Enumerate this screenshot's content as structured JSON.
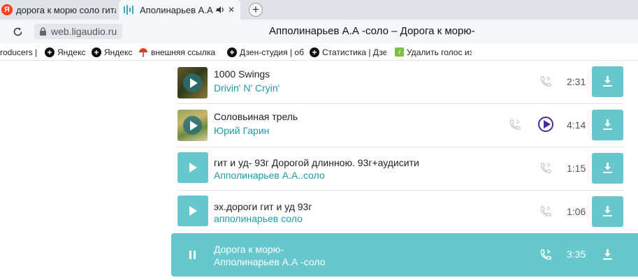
{
  "tabs": [
    {
      "label": "дорога к морю соло гитар",
      "icon": "yandex-icon",
      "icon_letter": "Я"
    },
    {
      "label": "Аполинарьев А.А -соло",
      "icon": "waveform-icon",
      "close": "✕"
    }
  ],
  "new_tab": "+",
  "address": {
    "url": "web.ligaudio.ru",
    "title": "Апполинарьев А.А -соло – Дорога к морю-"
  },
  "bookmarks": [
    {
      "label": "roducers |"
    },
    {
      "label": "Яндекс",
      "icon": "plus-icon"
    },
    {
      "label": "Яндекс",
      "icon": "plus-icon"
    },
    {
      "label": "внешняя ссылка |",
      "icon": "umbrella-icon"
    },
    {
      "label": "Дзен-студия | обз",
      "icon": "plus-icon"
    },
    {
      "label": "Статистика | Дзен",
      "icon": "plus-icon"
    },
    {
      "label": "Удалить голос из",
      "icon": "music-note-icon"
    }
  ],
  "tracks": [
    {
      "title": "1000 Swings",
      "artist": "Drivin' N' Cryin'",
      "duration": "2:31"
    },
    {
      "title": "Соловьиная трель",
      "artist": "Юрий Гарин",
      "duration": "4:14"
    },
    {
      "title": "гит и уд- 93г Дорогой длинною. 93г+аудисити",
      "artist": "Апполинарьев А.А..соло",
      "duration": "1:15"
    },
    {
      "title": "эх.дороги гит и уд 93г",
      "artist": "апполинарьев соло",
      "duration": "1:06"
    }
  ],
  "now_playing": {
    "title": "Дорога к морю-",
    "artist": "Апполинарьев А.А -соло",
    "duration": "3:35"
  },
  "colors": {
    "accent": "#66c7cd",
    "link": "#1e9aa6",
    "play_outline": "#4a2aa0"
  }
}
